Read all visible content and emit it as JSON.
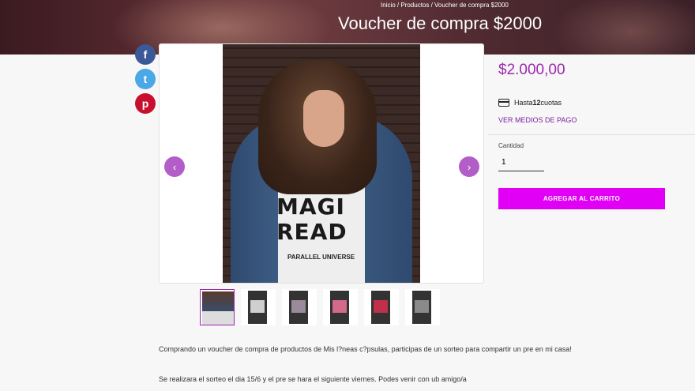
{
  "header": {
    "breadcrumb": "Inicio / Productos / Voucher de compra $2000",
    "title": "Voucher de compra $2000"
  },
  "share": {
    "facebook": "f",
    "twitter": "t",
    "pinterest": "p"
  },
  "gallery": {
    "shirt_text": "MAGI READ",
    "shirt_subtext": "PARALLEL UNIVERSE",
    "prev_icon": "‹",
    "next_icon": "›",
    "thumbnail_count": 6
  },
  "product": {
    "price": "$2.000,00",
    "installments_prefix": "Hasta ",
    "installments_count": "12",
    "installments_suffix": " cuotas",
    "payment_link": "VER MEDIOS DE PAGO",
    "quantity_label": "Cantidad",
    "quantity_value": "1",
    "add_to_cart": "AGREGAR AL CARRITO"
  },
  "description": {
    "p1": "Comprando un voucher de compra de productos de Mis l?neas c?psulas, participas de un sorteo para compartir un pre en mi casa!",
    "p2": "Se realizara el sorteo el dia 15/6 y el pre se hara el siguiente viernes. Podes venir con ub amigo/a"
  },
  "colors": {
    "accent": "#9c27b0",
    "button": "#e100f5",
    "facebook": "#3b5998",
    "twitter": "#4aa8e6",
    "pinterest": "#c8102e"
  }
}
